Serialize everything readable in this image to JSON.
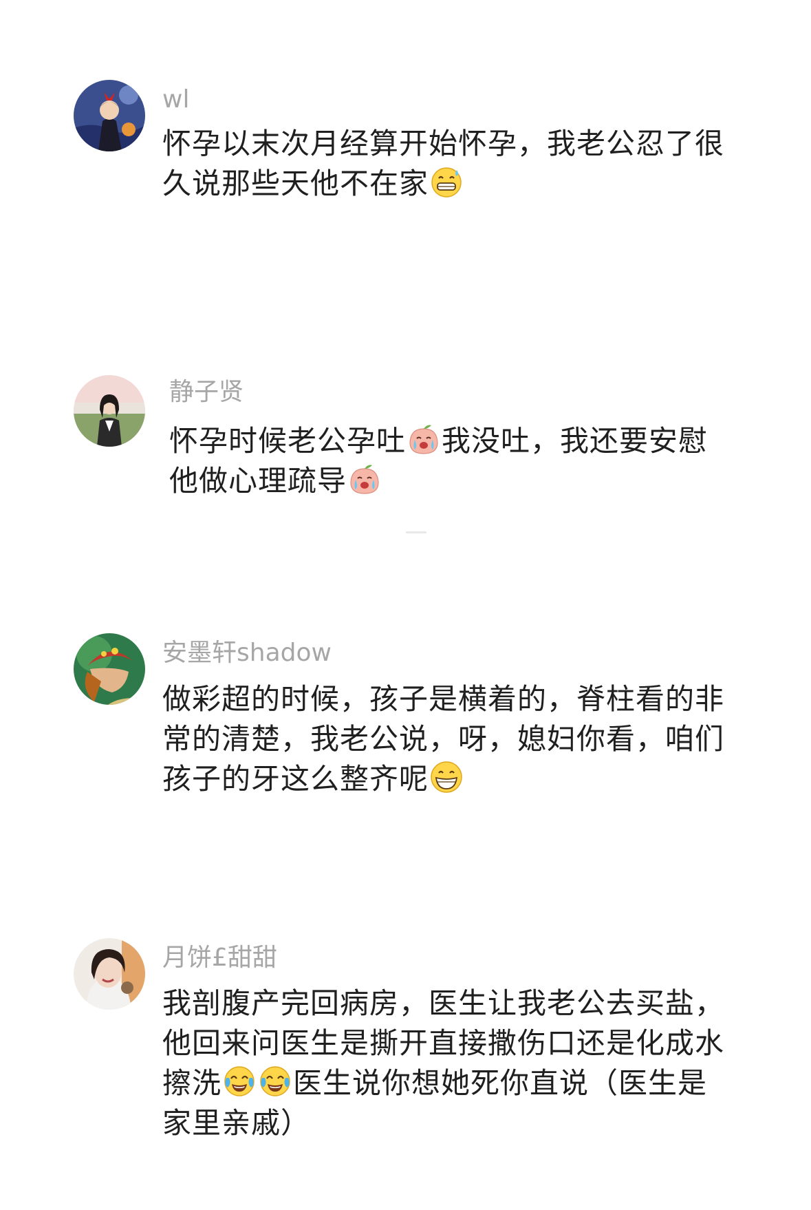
{
  "comments": [
    {
      "username": "wl",
      "text_parts": [
        "怀孕以末次月经算开始怀孕，我老公忍了很久说那些天他不在家"
      ],
      "emoji_after": "grin-sweat-emoji"
    },
    {
      "username": "静子贤",
      "text_parts": [
        "怀孕时候老公孕吐",
        "我没吐，我还要安慰他做心理疏导"
      ],
      "emoji": "crying-peach-emoji"
    },
    {
      "username": "安墨轩shadow",
      "text_parts": [
        "做彩超的时候，孩子是横着的，脊柱看的非常的清楚，我老公说，呀，媳妇你看，咱们孩子的牙这么整齐呢"
      ],
      "emoji_after": "big-grin-emoji"
    },
    {
      "username": "月饼£甜甜",
      "text_parts": [
        "我剖腹产完回病房，医生让我老公去买盐，他回来问医生是撕开直接撒伤口还是化成水擦洗",
        "医生说你想她死你直说（医生是家里亲戚）"
      ],
      "emoji": "tears-of-joy-emoji"
    }
  ],
  "colors": {
    "username": "#a6a6a6",
    "text": "#1f1f1f",
    "background": "#ffffff"
  }
}
